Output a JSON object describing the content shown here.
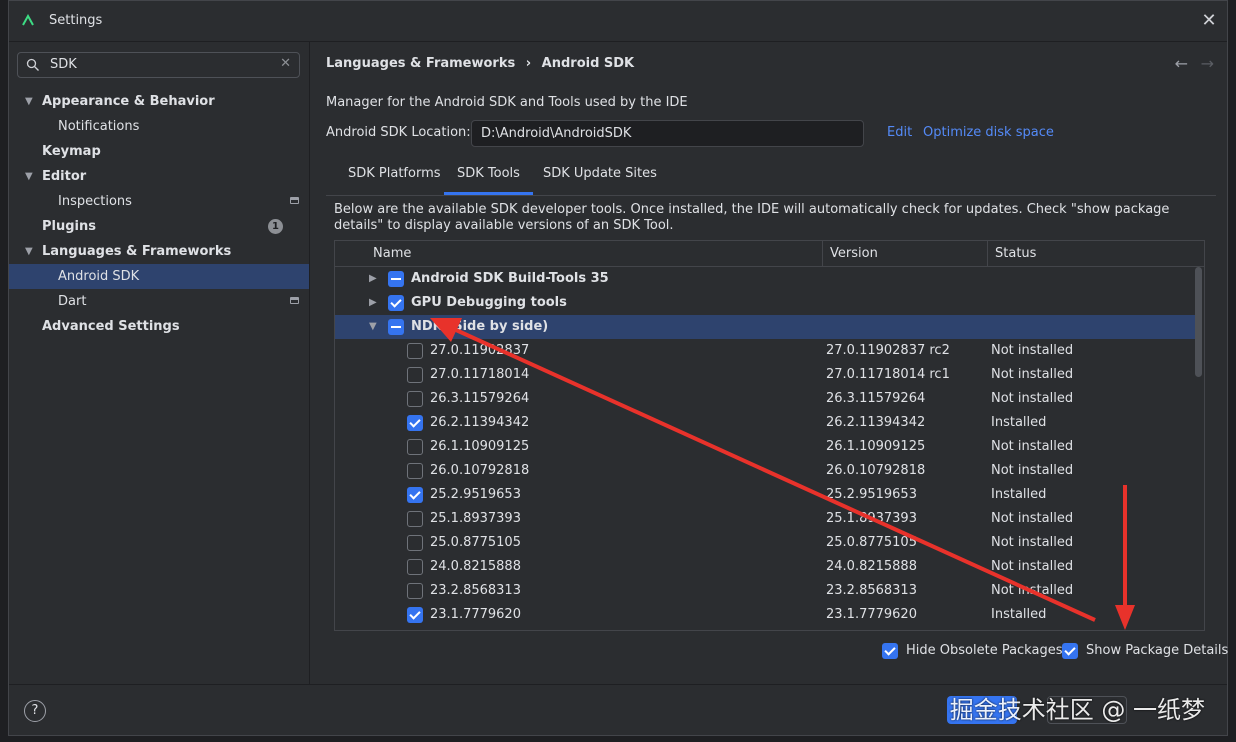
{
  "window": {
    "title": "Settings"
  },
  "sidebar": {
    "search_value": "SDK",
    "items": [
      {
        "label": "Appearance & Behavior",
        "expanded": true
      },
      {
        "label": "Notifications"
      },
      {
        "label": "Keymap"
      },
      {
        "label": "Editor",
        "expanded": true
      },
      {
        "label": "Inspections"
      },
      {
        "label": "Plugins",
        "badge": "1"
      },
      {
        "label": "Languages & Frameworks",
        "expanded": true
      },
      {
        "label": "Android SDK",
        "selected": true
      },
      {
        "label": "Dart"
      },
      {
        "label": "Advanced Settings"
      }
    ]
  },
  "main": {
    "breadcrumb": [
      "Languages & Frameworks",
      "Android SDK"
    ],
    "breadcrumb_sep": "›",
    "description": "Manager for the Android SDK and Tools used by the IDE",
    "location_label": "Android SDK Location:",
    "location_value": "D:\\Android\\AndroidSDK",
    "edit_link": "Edit",
    "optimize_link": "Optimize disk space",
    "tabs": [
      "SDK Platforms",
      "SDK Tools",
      "SDK Update Sites"
    ],
    "active_tab": "SDK Tools",
    "note": "Below are the available SDK developer tools. Once installed, the IDE will automatically check for updates. Check \"show package details\" to display available versions of an SDK Tool.",
    "table": {
      "headers": [
        "Name",
        "Version",
        "Status"
      ],
      "groups": [
        {
          "name": "Android SDK Build-Tools 35",
          "state": "mixed",
          "expanded": false
        },
        {
          "name": "GPU Debugging tools",
          "state": "checked",
          "expanded": false
        },
        {
          "name": "NDK (Side by side)",
          "state": "mixed",
          "expanded": true
        }
      ],
      "rows": [
        {
          "name": "27.0.11902837",
          "version": "27.0.11902837 rc2",
          "status": "Not installed",
          "checked": false
        },
        {
          "name": "27.0.11718014",
          "version": "27.0.11718014 rc1",
          "status": "Not installed",
          "checked": false
        },
        {
          "name": "26.3.11579264",
          "version": "26.3.11579264",
          "status": "Not installed",
          "checked": false
        },
        {
          "name": "26.2.11394342",
          "version": "26.2.11394342",
          "status": "Installed",
          "checked": true
        },
        {
          "name": "26.1.10909125",
          "version": "26.1.10909125",
          "status": "Not installed",
          "checked": false
        },
        {
          "name": "26.0.10792818",
          "version": "26.0.10792818",
          "status": "Not installed",
          "checked": false
        },
        {
          "name": "25.2.9519653",
          "version": "25.2.9519653",
          "status": "Installed",
          "checked": true
        },
        {
          "name": "25.1.8937393",
          "version": "25.1.8937393",
          "status": "Not installed",
          "checked": false
        },
        {
          "name": "25.0.8775105",
          "version": "25.0.8775105",
          "status": "Not installed",
          "checked": false
        },
        {
          "name": "24.0.8215888",
          "version": "24.0.8215888",
          "status": "Not installed",
          "checked": false
        },
        {
          "name": "23.2.8568313",
          "version": "23.2.8568313",
          "status": "Not installed",
          "checked": false
        },
        {
          "name": "23.1.7779620",
          "version": "23.1.7779620",
          "status": "Installed",
          "checked": true
        }
      ]
    },
    "hide_obsolete_label": "Hide Obsolete Packages",
    "hide_obsolete_checked": true,
    "show_details_label": "Show Package Details",
    "show_details_checked": true
  },
  "footer": {
    "help_label": "?",
    "watermark": "掘金技术社区 @ 一纸梦"
  },
  "colors": {
    "accent": "#3574f0",
    "selection": "#2e436e",
    "link": "#548af7",
    "annotation_arrow": "#e8322b"
  }
}
